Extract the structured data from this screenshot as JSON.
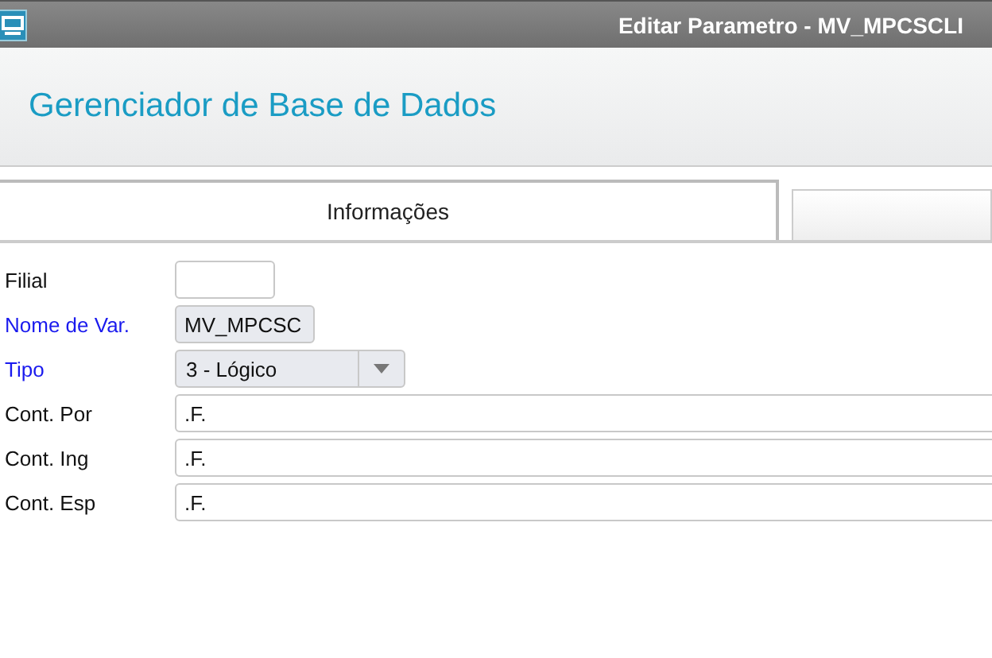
{
  "window": {
    "title": "Editar Parametro - MV_MPCSCLI"
  },
  "header": {
    "title": "Gerenciador de Base de Dados"
  },
  "tabs": [
    {
      "label": "Informações",
      "selected": true
    },
    {
      "selected": false
    }
  ],
  "fields": [
    {
      "label": "Filial",
      "required": false,
      "kind": "short"
    },
    {
      "label": "Nome de Var.",
      "required": true,
      "kind": "readonly",
      "value": "MV_MPCSC"
    },
    {
      "label": "Tipo",
      "required": true,
      "kind": "select",
      "value": "3 - Lógico"
    },
    {
      "label": "Cont. Por",
      "required": false,
      "kind": "text",
      "value": ".F."
    },
    {
      "label": "Cont. Ing",
      "required": false,
      "kind": "text",
      "value": ".F."
    },
    {
      "label": "Cont. Esp",
      "required": false,
      "kind": "text",
      "value": ".F."
    }
  ]
}
